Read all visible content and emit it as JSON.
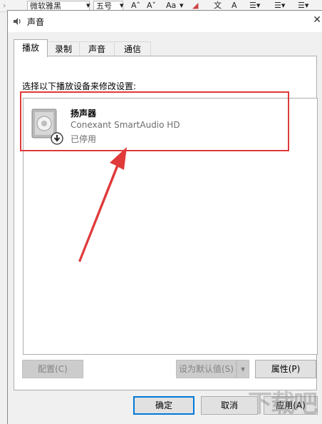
{
  "bg_toolbar": {
    "font_name": "微软雅黑",
    "font_size": "五号",
    "case_btn": "Aa"
  },
  "dialog": {
    "title": "声音",
    "tabs": [
      {
        "label": "播放"
      },
      {
        "label": "录制"
      },
      {
        "label": "声音"
      },
      {
        "label": "通信"
      }
    ],
    "prompt": "选择以下播放设备来修改设置:",
    "device": {
      "name": "扬声器",
      "description": "Conexant SmartAudio HD",
      "status": "已停用"
    },
    "buttons": {
      "configure": "配置(C)",
      "set_default": "设为默认值(S)",
      "properties": "属性(P)",
      "ok": "确定",
      "cancel": "取消",
      "apply": "应用(A)"
    }
  },
  "annotation_color": "#e03a3a",
  "accent_color": "#0078d7"
}
